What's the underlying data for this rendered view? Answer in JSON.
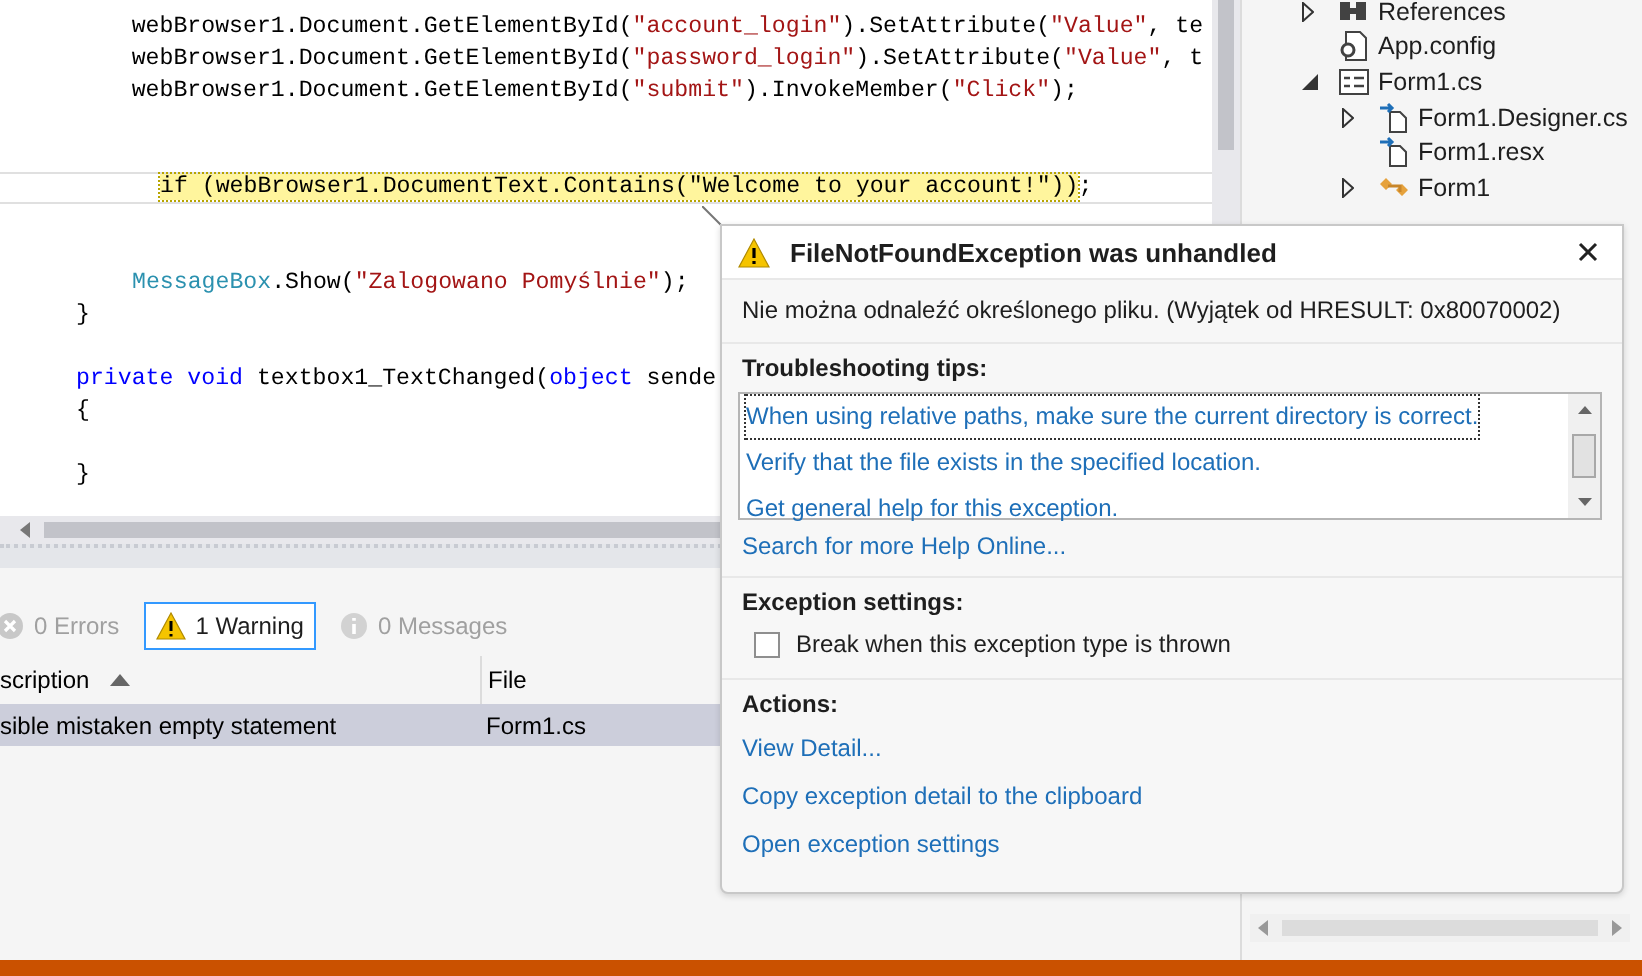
{
  "editor": {
    "lines": [
      {
        "kind": "code",
        "tokens": [
          {
            "kind": "plain",
            "text": "    webBrowser1.Document.GetElementById(",
            "highlighted": false
          },
          {
            "kind": "string",
            "text": "\"account_login\"",
            "highlighted": false
          },
          {
            "kind": "plain",
            "text": ").SetAttribute(",
            "highlighted": false
          },
          {
            "kind": "string",
            "text": "\"Value\"",
            "highlighted": false
          },
          {
            "kind": "plain",
            "text": ", te",
            "highlighted": false
          }
        ]
      },
      {
        "kind": "code",
        "tokens": [
          {
            "kind": "plain",
            "text": "    webBrowser1.Document.GetElementById(",
            "highlighted": false
          },
          {
            "kind": "string",
            "text": "\"password_login\"",
            "highlighted": false
          },
          {
            "kind": "plain",
            "text": ").SetAttribute(",
            "highlighted": false
          },
          {
            "kind": "string",
            "text": "\"Value\"",
            "highlighted": false
          },
          {
            "kind": "plain",
            "text": ", t",
            "highlighted": false
          }
        ]
      },
      {
        "kind": "code",
        "tokens": [
          {
            "kind": "plain",
            "text": "    webBrowser1.Document.GetElementById(",
            "highlighted": false
          },
          {
            "kind": "string",
            "text": "\"submit\"",
            "highlighted": false
          },
          {
            "kind": "plain",
            "text": ").InvokeMember(",
            "highlighted": false
          },
          {
            "kind": "string",
            "text": "\"Click\"",
            "highlighted": false
          },
          {
            "kind": "plain",
            "text": ");",
            "highlighted": false
          }
        ]
      },
      {
        "kind": "blank"
      },
      {
        "kind": "blank"
      },
      {
        "kind": "current",
        "tokens": [
          {
            "kind": "plain",
            "text": "if (webBrowser1.DocumentText.Contains(\"Welcome to your account!\"))",
            "highlighted": true
          },
          {
            "kind": "plain",
            "text": ";",
            "highlighted": false
          }
        ]
      },
      {
        "kind": "blank"
      },
      {
        "kind": "blank"
      },
      {
        "kind": "body",
        "tokens": [
          {
            "kind": "type",
            "text": "MessageBox",
            "highlighted": false
          },
          {
            "kind": "plain",
            "text": ".Show(",
            "highlighted": false
          },
          {
            "kind": "string",
            "text": "\"Zalogowano Pomyślnie\"",
            "highlighted": false
          },
          {
            "kind": "plain",
            "text": ");",
            "highlighted": false
          }
        ]
      },
      {
        "kind": "code",
        "tokens": [
          {
            "kind": "plain",
            "text": "}",
            "highlighted": false
          }
        ]
      },
      {
        "kind": "blank"
      },
      {
        "kind": "code",
        "tokens": [
          {
            "kind": "keyword",
            "text": "private",
            "highlighted": false
          },
          {
            "kind": "keyword",
            "text": " void",
            "highlighted": false
          },
          {
            "kind": "plain",
            "text": " textbox1_TextChanged(",
            "highlighted": false
          },
          {
            "kind": "keyword",
            "text": "object",
            "highlighted": false
          },
          {
            "kind": "plain",
            "text": " sende",
            "highlighted": false
          }
        ]
      },
      {
        "kind": "code",
        "tokens": [
          {
            "kind": "plain",
            "text": "{",
            "highlighted": false
          }
        ]
      },
      {
        "kind": "blank"
      },
      {
        "kind": "code",
        "tokens": [
          {
            "kind": "plain",
            "text": "}",
            "highlighted": false
          }
        ]
      }
    ]
  },
  "error_list": {
    "filters": [
      {
        "kind": "error",
        "label": "0 Errors",
        "selected": false,
        "disabled": true
      },
      {
        "kind": "warning",
        "label": "1 Warning",
        "selected": true,
        "disabled": false
      },
      {
        "kind": "message",
        "label": "0 Messages",
        "selected": false,
        "disabled": true
      }
    ],
    "columns": [
      {
        "label": "scription",
        "sorted": true
      },
      {
        "label": "File",
        "sorted": false
      }
    ],
    "rows": [
      {
        "cells": [
          "sible mistaken empty statement",
          "Form1.cs"
        ],
        "selected": true
      }
    ]
  },
  "solution_explorer": {
    "items": [
      {
        "label": "References",
        "kind": "references",
        "expanded": false
      },
      {
        "label": "App.config",
        "kind": "config"
      },
      {
        "label": "Form1.cs",
        "kind": "form",
        "expanded": true,
        "children": [
          {
            "label": "Form1.Designer.cs",
            "kind": "dependent",
            "expanded": false
          },
          {
            "label": "Form1.resx",
            "kind": "dependent"
          },
          {
            "label": "Form1",
            "kind": "class",
            "expanded": false
          }
        ]
      }
    ]
  },
  "exception_helper": {
    "title": "FileNotFoundException was unhandled",
    "message": "Nie można odnaleźć określonego pliku. (Wyjątek od HRESULT: 0x80070002)",
    "troubleshooting": {
      "heading": "Troubleshooting tips:",
      "tips": [
        {
          "text": "When using relative paths, make sure the current directory is correct.",
          "focused": true
        },
        {
          "text": "Verify that the file exists in the specified location.",
          "focused": false
        },
        {
          "text": "Get general help for this exception.",
          "focused": false
        }
      ],
      "more_link": "Search for more Help Online..."
    },
    "settings": {
      "heading": "Exception settings:",
      "option": {
        "label": "Break when this exception type is thrown",
        "checked": false
      }
    },
    "actions": {
      "heading": "Actions:",
      "links": [
        "View Detail...",
        "Copy exception detail to the clipboard",
        "Open exception settings"
      ]
    }
  }
}
